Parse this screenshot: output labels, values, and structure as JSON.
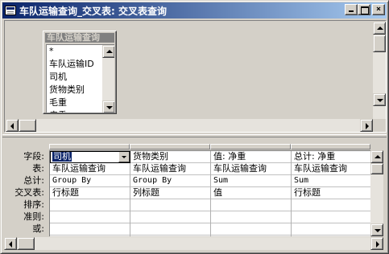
{
  "window": {
    "title": "车队运输查询_交叉表: 交叉表查询",
    "minimize_label": "",
    "maximize_label": "",
    "close_label": "×"
  },
  "table_box": {
    "title": "车队运输查询",
    "fields": [
      "*",
      "车队运输ID",
      "司机",
      "货物类别",
      "毛重",
      "皮重"
    ]
  },
  "grid": {
    "row_labels": [
      "字段:",
      "表:",
      "总计:",
      "交叉表:",
      "排序:",
      "准则:",
      "或:"
    ],
    "columns": [
      {
        "field": "司机",
        "table": "车队运输查询",
        "total": "Group By",
        "crosstab": "行标题",
        "sort": "",
        "criteria": "",
        "or": ""
      },
      {
        "field": "货物类别",
        "table": "车队运输查询",
        "total": "Group By",
        "crosstab": "列标题",
        "sort": "",
        "criteria": "",
        "or": ""
      },
      {
        "field": "值: 净重",
        "table": "车队运输查询",
        "total": "Sum",
        "crosstab": "值",
        "sort": "",
        "criteria": "",
        "or": ""
      },
      {
        "field": "总计: 净重",
        "table": "车队运输查询",
        "total": "Sum",
        "crosstab": "行标题",
        "sort": "",
        "criteria": "",
        "or": ""
      }
    ]
  }
}
